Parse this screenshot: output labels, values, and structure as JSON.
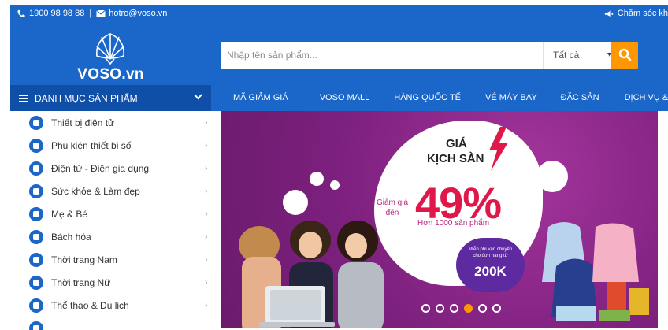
{
  "topbar": {
    "phone": "1900 98 98 88",
    "separator": "|",
    "email": "hotro@voso.vn",
    "customer_care": "Chăm sóc kh"
  },
  "header": {
    "logo_text": "VOSO.vn",
    "search": {
      "placeholder": "Nhập tên sản phẩm...",
      "category_value": "Tất cả"
    }
  },
  "nav": {
    "category_label": "DANH MỤC SẢN PHẨM",
    "items": [
      "MÃ GIẢM GIÁ",
      "VOSO MALL",
      "HÀNG QUỐC TẾ",
      "VÉ MÁY BAY",
      "ĐẶC SẢN",
      "DỊCH VỤ & N"
    ]
  },
  "sidebar": {
    "items": [
      {
        "label": "Thiết bị điện tử",
        "icon": "electronics-icon"
      },
      {
        "label": "Phụ kiện thiết bị số",
        "icon": "phone-accessory-icon"
      },
      {
        "label": "Điện tử - Điện gia dụng",
        "icon": "appliance-icon"
      },
      {
        "label": "Sức khỏe & Làm đẹp",
        "icon": "health-beauty-icon"
      },
      {
        "label": "Mẹ & Bé",
        "icon": "mother-baby-icon"
      },
      {
        "label": "Bách hóa",
        "icon": "grocery-icon"
      },
      {
        "label": "Thời trang Nam",
        "icon": "men-fashion-icon"
      },
      {
        "label": "Thời trang Nữ",
        "icon": "women-fashion-icon"
      },
      {
        "label": "Thể thao & Du lịch",
        "icon": "sport-travel-icon"
      }
    ],
    "arrow": "›"
  },
  "banner": {
    "headline_1": "GIÁ",
    "headline_2": "KỊCH SÀN",
    "discount_prefix_1": "Giảm giá",
    "discount_prefix_2": "đến",
    "discount": "49%",
    "sub": "Hơn 1000 sản phẩm",
    "shipping_1": "Miễn phí vận chuyển",
    "shipping_2": "cho đơn hàng từ",
    "shipping_amount": "200K",
    "slide_count": 6,
    "active_slide": 4
  },
  "colors": {
    "brand_blue": "#1b66c9",
    "dark_blue": "#0f4fa8",
    "accent_orange": "#ff9800",
    "banner_purple": "#7d207e",
    "sale_red": "#e0184a"
  }
}
